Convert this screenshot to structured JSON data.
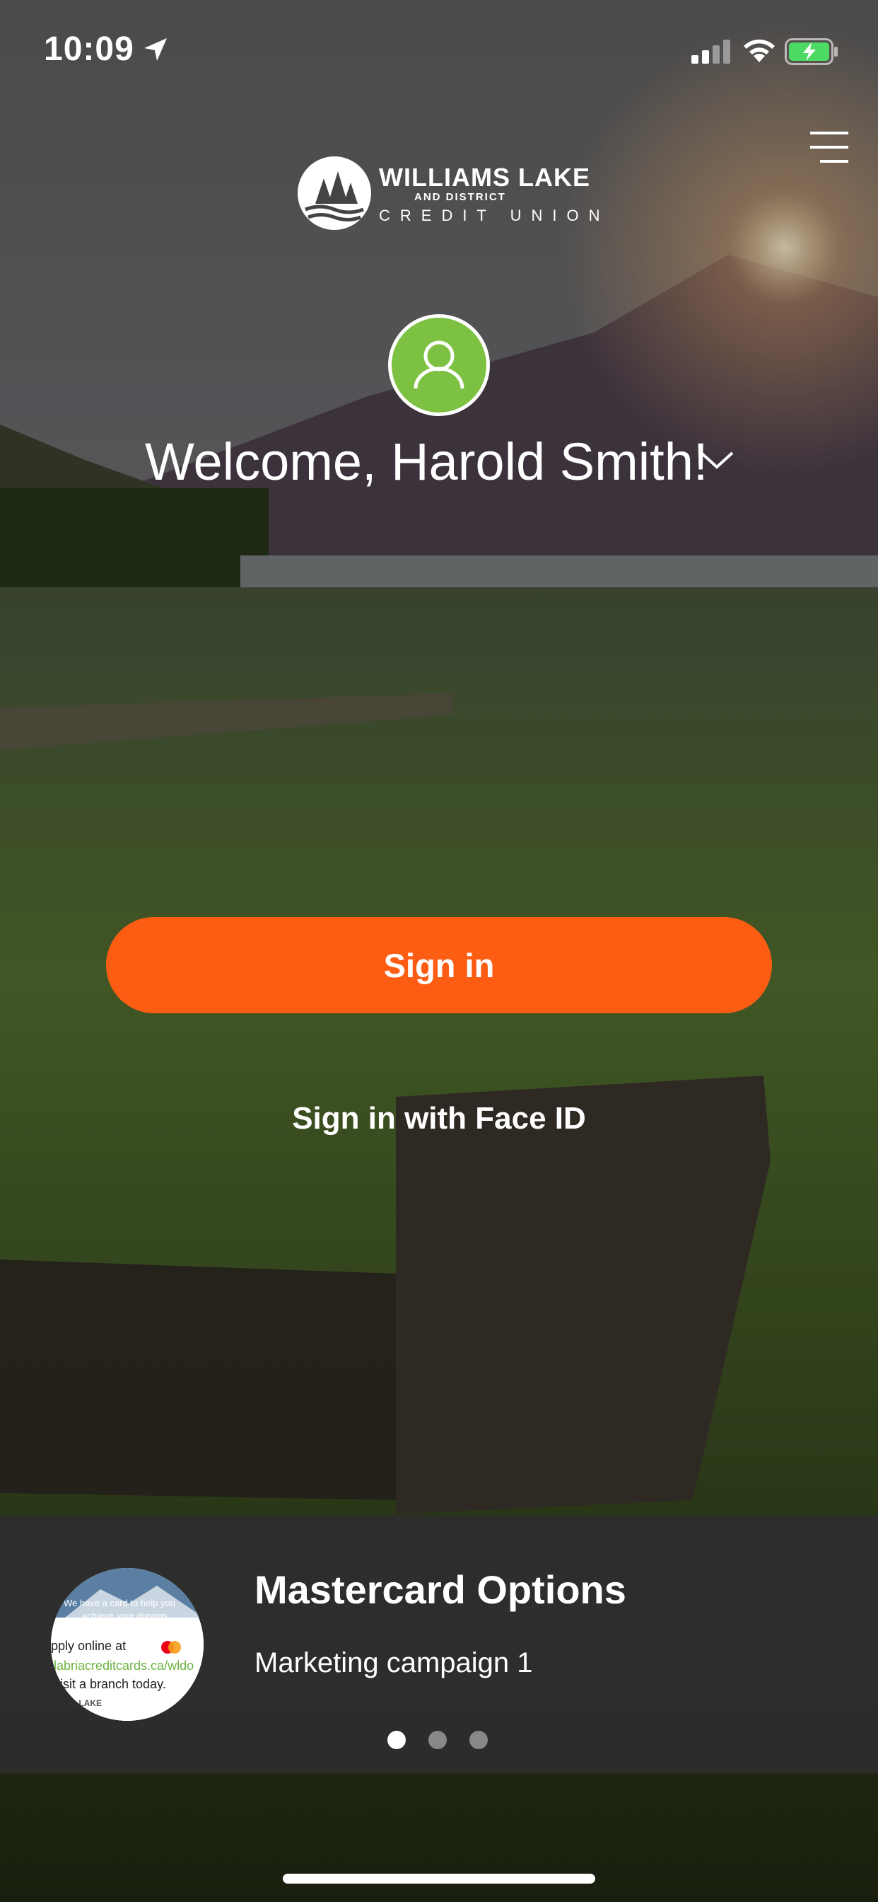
{
  "status_bar": {
    "time": "10:09"
  },
  "brand": {
    "line1": "WILLIAMS LAKE",
    "line2": "AND DISTRICT",
    "line3": "CREDIT UNION"
  },
  "welcome": {
    "text": "Welcome, Harold Smith!"
  },
  "actions": {
    "sign_in_label": "Sign in",
    "face_id_label": "Sign in with Face ID"
  },
  "promo": {
    "title": "Mastercard Options",
    "subtitle": "Marketing campaign 1",
    "thumbnail_text": {
      "line1": "We have a card to help you",
      "line2": "achieve your dreams.",
      "line3": "pply online at",
      "line4": "llabriacreditcards.ca/wldo",
      "line5": "visit a branch today.",
      "line6": "MS LAKE"
    },
    "pages": 3,
    "active_page": 1
  },
  "colors": {
    "accent_orange": "#fd5d13",
    "avatar_green": "#7cc142",
    "card_bg": "#2d2d2d"
  },
  "icons": [
    "location-arrow-icon",
    "signal-icon",
    "wifi-icon",
    "battery-charging-icon",
    "hamburger-menu-icon",
    "user-icon",
    "chevron-down-icon"
  ]
}
